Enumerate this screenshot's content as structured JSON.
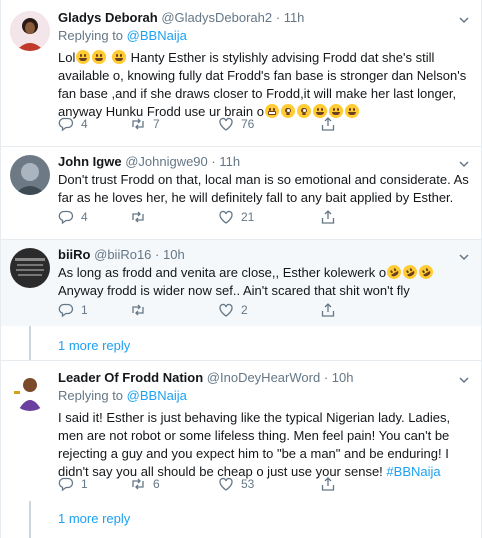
{
  "tweets": [
    {
      "name": "Gladys Deborah",
      "handle": "@GladysDeborah2",
      "sep": "·",
      "time": "11h",
      "replying_label": "Replying to",
      "replying_to": "@BBNaija",
      "text_a": "Lol",
      "text_b": "Hanty Esther is stylishly advising Frodd dat she's still available o, knowing fully dat Frodd's fan base is stronger dan Nelson's fan base ,and if she draws closer to Frodd,it will make her last longer, anyway Hunku Frodd use ur brain o",
      "replies": "4",
      "retweets": "7",
      "likes": "76"
    },
    {
      "name": "John Igwe",
      "handle": "@Johnigwe90",
      "sep": "·",
      "time": "11h",
      "text": "Don't trust Frodd on that, local man is so emotional and considerate. As far as he loves her, he will definitely fall to any bait applied by Esther.",
      "replies": "4",
      "retweets": "",
      "likes": "21"
    },
    {
      "name": "biiRo",
      "handle": "@biiRo16",
      "sep": "·",
      "time": "10h",
      "text_a": "As long as frodd and venita are close,, Esther kolewerk o",
      "text_b": "Anyway frodd is wider now sef.. Ain't scared that shit won't fly",
      "replies": "1",
      "retweets": "",
      "likes": "2"
    },
    {
      "name": "Leader Of Frodd Nation",
      "handle": "@InoDeyHearWord",
      "sep": "·",
      "time": "10h",
      "replying_label": "Replying to",
      "replying_to": "@BBNaija",
      "text_a": "I said it! Esther is just behaving like the typical Nigerian lady. Ladies, men are not robot or some lifeless thing. Men feel pain! You can't be rejecting a guy and you expect him to \"be a man\" and be enduring! I didn't say you all should be cheap o just use your sense!",
      "hashtag": "#BBNaija",
      "replies": "1",
      "retweets": "6",
      "likes": "53"
    }
  ],
  "more_replies_1": "1 more reply",
  "more_replies_2": "1 more reply",
  "colors": {
    "accent": "#1da1f2",
    "muted": "#657786",
    "border": "#e6ecf0",
    "shaded": "#f5f8fa"
  },
  "icons": [
    "reply-icon",
    "retweet-icon",
    "like-icon",
    "share-icon",
    "caret-down-icon"
  ]
}
